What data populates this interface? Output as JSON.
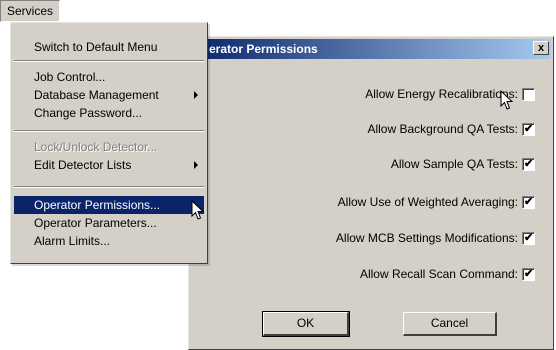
{
  "menubar": {
    "services_label": "Services"
  },
  "menu": {
    "items": [
      {
        "label": "Switch to Default Menu"
      },
      {
        "label": "Job Control..."
      },
      {
        "label": "Database Management"
      },
      {
        "label": "Change Password..."
      },
      {
        "label": "Lock/Unlock Detector..."
      },
      {
        "label": "Edit Detector Lists"
      },
      {
        "label": "Operator Permissions..."
      },
      {
        "label": "Operator Parameters..."
      },
      {
        "label": "Alarm Limits..."
      }
    ]
  },
  "dialog": {
    "title": "erator Permissions",
    "close_label": "x",
    "permissions": [
      {
        "label": "Allow Energy Recalibrations:",
        "checked": false
      },
      {
        "label": "Allow Background QA Tests:",
        "checked": true
      },
      {
        "label": "Allow Sample QA Tests:",
        "checked": true
      },
      {
        "label": "Allow Use of Weighted Averaging:",
        "checked": true
      },
      {
        "label": "Allow MCB Settings Modifications:",
        "checked": true
      },
      {
        "label": "Allow Recall Scan Command:",
        "checked": true
      }
    ],
    "ok_label": "OK",
    "cancel_label": "Cancel"
  },
  "colors": {
    "face": "#d4d0c8",
    "highlight": "#0a246a",
    "title_gradient_end": "#a6caf0",
    "disabled_text": "#808080"
  }
}
